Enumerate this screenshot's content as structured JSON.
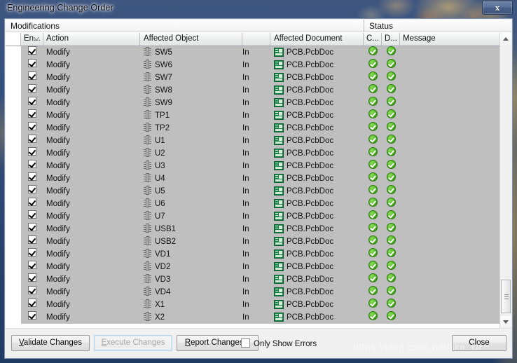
{
  "window": {
    "title": "Engineering Change Order",
    "close_glyph": "x"
  },
  "panel": {
    "section_title": "Modifications",
    "status_group_title": "Status"
  },
  "table": {
    "columns": [
      {
        "key": "blank",
        "label": ""
      },
      {
        "key": "enabled",
        "label": "En...",
        "sorted": true
      },
      {
        "key": "action",
        "label": "Action"
      },
      {
        "key": "object",
        "label": "Affected Object"
      },
      {
        "key": "dir",
        "label": ""
      },
      {
        "key": "doc",
        "label": "Affected Document"
      },
      {
        "key": "check",
        "label": "C..."
      },
      {
        "key": "done",
        "label": "D..."
      },
      {
        "key": "message",
        "label": "Message"
      }
    ],
    "rows": [
      {
        "enabled": true,
        "action": "Modify",
        "object": "SW5",
        "dir": "In",
        "doc": "PCB.PcbDoc",
        "check": "ok",
        "done": "ok",
        "message": ""
      },
      {
        "enabled": true,
        "action": "Modify",
        "object": "SW6",
        "dir": "In",
        "doc": "PCB.PcbDoc",
        "check": "ok",
        "done": "ok",
        "message": ""
      },
      {
        "enabled": true,
        "action": "Modify",
        "object": "SW7",
        "dir": "In",
        "doc": "PCB.PcbDoc",
        "check": "ok",
        "done": "ok",
        "message": ""
      },
      {
        "enabled": true,
        "action": "Modify",
        "object": "SW8",
        "dir": "In",
        "doc": "PCB.PcbDoc",
        "check": "ok",
        "done": "ok",
        "message": ""
      },
      {
        "enabled": true,
        "action": "Modify",
        "object": "SW9",
        "dir": "In",
        "doc": "PCB.PcbDoc",
        "check": "ok",
        "done": "ok",
        "message": ""
      },
      {
        "enabled": true,
        "action": "Modify",
        "object": "TP1",
        "dir": "In",
        "doc": "PCB.PcbDoc",
        "check": "ok",
        "done": "ok",
        "message": ""
      },
      {
        "enabled": true,
        "action": "Modify",
        "object": "TP2",
        "dir": "In",
        "doc": "PCB.PcbDoc",
        "check": "ok",
        "done": "ok",
        "message": ""
      },
      {
        "enabled": true,
        "action": "Modify",
        "object": "U1",
        "dir": "In",
        "doc": "PCB.PcbDoc",
        "check": "ok",
        "done": "ok",
        "message": ""
      },
      {
        "enabled": true,
        "action": "Modify",
        "object": "U2",
        "dir": "In",
        "doc": "PCB.PcbDoc",
        "check": "ok",
        "done": "ok",
        "message": ""
      },
      {
        "enabled": true,
        "action": "Modify",
        "object": "U3",
        "dir": "In",
        "doc": "PCB.PcbDoc",
        "check": "ok",
        "done": "ok",
        "message": ""
      },
      {
        "enabled": true,
        "action": "Modify",
        "object": "U4",
        "dir": "In",
        "doc": "PCB.PcbDoc",
        "check": "ok",
        "done": "ok",
        "message": ""
      },
      {
        "enabled": true,
        "action": "Modify",
        "object": "U5",
        "dir": "In",
        "doc": "PCB.PcbDoc",
        "check": "ok",
        "done": "ok",
        "message": ""
      },
      {
        "enabled": true,
        "action": "Modify",
        "object": "U6",
        "dir": "In",
        "doc": "PCB.PcbDoc",
        "check": "ok",
        "done": "ok",
        "message": ""
      },
      {
        "enabled": true,
        "action": "Modify",
        "object": "U7",
        "dir": "In",
        "doc": "PCB.PcbDoc",
        "check": "ok",
        "done": "ok",
        "message": ""
      },
      {
        "enabled": true,
        "action": "Modify",
        "object": "USB1",
        "dir": "In",
        "doc": "PCB.PcbDoc",
        "check": "ok",
        "done": "ok",
        "message": ""
      },
      {
        "enabled": true,
        "action": "Modify",
        "object": "USB2",
        "dir": "In",
        "doc": "PCB.PcbDoc",
        "check": "ok",
        "done": "ok",
        "message": ""
      },
      {
        "enabled": true,
        "action": "Modify",
        "object": "VD1",
        "dir": "In",
        "doc": "PCB.PcbDoc",
        "check": "ok",
        "done": "ok",
        "message": ""
      },
      {
        "enabled": true,
        "action": "Modify",
        "object": "VD2",
        "dir": "In",
        "doc": "PCB.PcbDoc",
        "check": "ok",
        "done": "ok",
        "message": ""
      },
      {
        "enabled": true,
        "action": "Modify",
        "object": "VD3",
        "dir": "In",
        "doc": "PCB.PcbDoc",
        "check": "ok",
        "done": "ok",
        "message": ""
      },
      {
        "enabled": true,
        "action": "Modify",
        "object": "VD4",
        "dir": "In",
        "doc": "PCB.PcbDoc",
        "check": "ok",
        "done": "ok",
        "message": ""
      },
      {
        "enabled": true,
        "action": "Modify",
        "object": "X1",
        "dir": "In",
        "doc": "PCB.PcbDoc",
        "check": "ok",
        "done": "ok",
        "message": ""
      },
      {
        "enabled": true,
        "action": "Modify",
        "object": "X2",
        "dir": "In",
        "doc": "PCB.PcbDoc",
        "check": "ok",
        "done": "ok",
        "message": ""
      }
    ]
  },
  "scrollbar": {
    "up_arrow": "scroll-up",
    "down_arrow": "scroll-down",
    "thumb_position_percent": 88
  },
  "buttons": {
    "validate": {
      "label": "Validate Changes",
      "accel": "V",
      "disabled": false
    },
    "execute": {
      "label": "Execute Changes",
      "accel": "E",
      "disabled": true
    },
    "report": {
      "label": "Report Changes...",
      "accel": "R",
      "disabled": false
    },
    "close": {
      "label": "Close",
      "disabled": false
    }
  },
  "only_show_errors": {
    "label": "Only Show Errors",
    "checked": false
  },
  "watermark": {
    "text": "https://blog.csdn.net/like_UI"
  },
  "colors": {
    "titlebar_start": "#3e5680",
    "titlebar_end": "#203a63",
    "row_band": "#bfbfbf",
    "status_ok": "#55bb27",
    "client_bg": "#f0f0f0"
  }
}
